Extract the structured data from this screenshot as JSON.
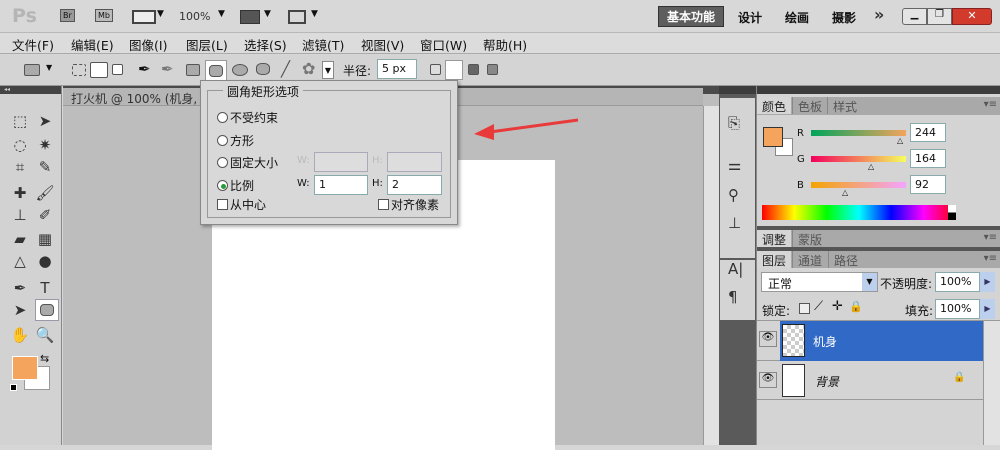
{
  "titlebar": {
    "logo": "Ps",
    "bridge": "Br",
    "minibridge": "Mb",
    "zoom": "100%",
    "workspaces": [
      "基本功能",
      "设计",
      "绘画",
      "摄影"
    ],
    "more": "»"
  },
  "menu": [
    "文件(F)",
    "编辑(E)",
    "图像(I)",
    "图层(L)",
    "选择(S)",
    "滤镜(T)",
    "视图(V)",
    "窗口(W)",
    "帮助(H)"
  ],
  "options": {
    "radius_label": "半径:",
    "radius_value": "5 px"
  },
  "document": {
    "tab_title": "打火机 @ 100% (机身,"
  },
  "dialog": {
    "title": "圆角矩形选项",
    "options": [
      "不受约束",
      "方形",
      "固定大小",
      "比例"
    ],
    "selected": "比例",
    "w_label": "W:",
    "h_label": "H:",
    "w_value": "1",
    "h_value": "2",
    "from_center": "从中心",
    "snap_pixels": "对齐像素"
  },
  "color_panel": {
    "tabs": [
      "颜色",
      "色板",
      "样式"
    ],
    "r_label": "R",
    "g_label": "G",
    "b_label": "B",
    "r": "244",
    "g": "164",
    "b": "92",
    "foreground": "#f4a45c"
  },
  "adjust_panel": {
    "tabs": [
      "调整",
      "蒙版"
    ]
  },
  "layers_panel": {
    "tabs": [
      "图层",
      "通道",
      "路径"
    ],
    "blend_mode": "正常",
    "opacity_label": "不透明度:",
    "opacity": "100%",
    "lock_label": "锁定:",
    "fill_label": "填充:",
    "fill": "100%",
    "layers": [
      {
        "name": "机身",
        "selected": true
      },
      {
        "name": "背景",
        "locked": true
      }
    ]
  },
  "colors": {
    "selection": "#3169c6",
    "arrow": "#e83a3a"
  }
}
